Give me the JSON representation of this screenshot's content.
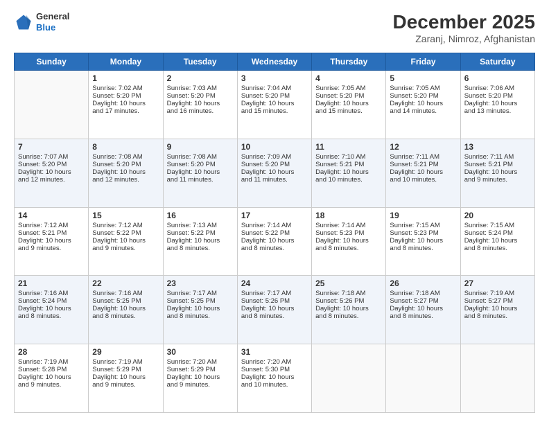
{
  "header": {
    "logo": {
      "general": "General",
      "blue": "Blue"
    },
    "title": "December 2025",
    "subtitle": "Zaranj, Nimroz, Afghanistan"
  },
  "days_of_week": [
    "Sunday",
    "Monday",
    "Tuesday",
    "Wednesday",
    "Thursday",
    "Friday",
    "Saturday"
  ],
  "weeks": [
    [
      {
        "num": "",
        "lines": []
      },
      {
        "num": "1",
        "lines": [
          "Sunrise: 7:02 AM",
          "Sunset: 5:20 PM",
          "Daylight: 10 hours",
          "and 17 minutes."
        ]
      },
      {
        "num": "2",
        "lines": [
          "Sunrise: 7:03 AM",
          "Sunset: 5:20 PM",
          "Daylight: 10 hours",
          "and 16 minutes."
        ]
      },
      {
        "num": "3",
        "lines": [
          "Sunrise: 7:04 AM",
          "Sunset: 5:20 PM",
          "Daylight: 10 hours",
          "and 15 minutes."
        ]
      },
      {
        "num": "4",
        "lines": [
          "Sunrise: 7:05 AM",
          "Sunset: 5:20 PM",
          "Daylight: 10 hours",
          "and 15 minutes."
        ]
      },
      {
        "num": "5",
        "lines": [
          "Sunrise: 7:05 AM",
          "Sunset: 5:20 PM",
          "Daylight: 10 hours",
          "and 14 minutes."
        ]
      },
      {
        "num": "6",
        "lines": [
          "Sunrise: 7:06 AM",
          "Sunset: 5:20 PM",
          "Daylight: 10 hours",
          "and 13 minutes."
        ]
      }
    ],
    [
      {
        "num": "7",
        "lines": [
          "Sunrise: 7:07 AM",
          "Sunset: 5:20 PM",
          "Daylight: 10 hours",
          "and 12 minutes."
        ]
      },
      {
        "num": "8",
        "lines": [
          "Sunrise: 7:08 AM",
          "Sunset: 5:20 PM",
          "Daylight: 10 hours",
          "and 12 minutes."
        ]
      },
      {
        "num": "9",
        "lines": [
          "Sunrise: 7:08 AM",
          "Sunset: 5:20 PM",
          "Daylight: 10 hours",
          "and 11 minutes."
        ]
      },
      {
        "num": "10",
        "lines": [
          "Sunrise: 7:09 AM",
          "Sunset: 5:20 PM",
          "Daylight: 10 hours",
          "and 11 minutes."
        ]
      },
      {
        "num": "11",
        "lines": [
          "Sunrise: 7:10 AM",
          "Sunset: 5:21 PM",
          "Daylight: 10 hours",
          "and 10 minutes."
        ]
      },
      {
        "num": "12",
        "lines": [
          "Sunrise: 7:11 AM",
          "Sunset: 5:21 PM",
          "Daylight: 10 hours",
          "and 10 minutes."
        ]
      },
      {
        "num": "13",
        "lines": [
          "Sunrise: 7:11 AM",
          "Sunset: 5:21 PM",
          "Daylight: 10 hours",
          "and 9 minutes."
        ]
      }
    ],
    [
      {
        "num": "14",
        "lines": [
          "Sunrise: 7:12 AM",
          "Sunset: 5:21 PM",
          "Daylight: 10 hours",
          "and 9 minutes."
        ]
      },
      {
        "num": "15",
        "lines": [
          "Sunrise: 7:12 AM",
          "Sunset: 5:22 PM",
          "Daylight: 10 hours",
          "and 9 minutes."
        ]
      },
      {
        "num": "16",
        "lines": [
          "Sunrise: 7:13 AM",
          "Sunset: 5:22 PM",
          "Daylight: 10 hours",
          "and 8 minutes."
        ]
      },
      {
        "num": "17",
        "lines": [
          "Sunrise: 7:14 AM",
          "Sunset: 5:22 PM",
          "Daylight: 10 hours",
          "and 8 minutes."
        ]
      },
      {
        "num": "18",
        "lines": [
          "Sunrise: 7:14 AM",
          "Sunset: 5:23 PM",
          "Daylight: 10 hours",
          "and 8 minutes."
        ]
      },
      {
        "num": "19",
        "lines": [
          "Sunrise: 7:15 AM",
          "Sunset: 5:23 PM",
          "Daylight: 10 hours",
          "and 8 minutes."
        ]
      },
      {
        "num": "20",
        "lines": [
          "Sunrise: 7:15 AM",
          "Sunset: 5:24 PM",
          "Daylight: 10 hours",
          "and 8 minutes."
        ]
      }
    ],
    [
      {
        "num": "21",
        "lines": [
          "Sunrise: 7:16 AM",
          "Sunset: 5:24 PM",
          "Daylight: 10 hours",
          "and 8 minutes."
        ]
      },
      {
        "num": "22",
        "lines": [
          "Sunrise: 7:16 AM",
          "Sunset: 5:25 PM",
          "Daylight: 10 hours",
          "and 8 minutes."
        ]
      },
      {
        "num": "23",
        "lines": [
          "Sunrise: 7:17 AM",
          "Sunset: 5:25 PM",
          "Daylight: 10 hours",
          "and 8 minutes."
        ]
      },
      {
        "num": "24",
        "lines": [
          "Sunrise: 7:17 AM",
          "Sunset: 5:26 PM",
          "Daylight: 10 hours",
          "and 8 minutes."
        ]
      },
      {
        "num": "25",
        "lines": [
          "Sunrise: 7:18 AM",
          "Sunset: 5:26 PM",
          "Daylight: 10 hours",
          "and 8 minutes."
        ]
      },
      {
        "num": "26",
        "lines": [
          "Sunrise: 7:18 AM",
          "Sunset: 5:27 PM",
          "Daylight: 10 hours",
          "and 8 minutes."
        ]
      },
      {
        "num": "27",
        "lines": [
          "Sunrise: 7:19 AM",
          "Sunset: 5:27 PM",
          "Daylight: 10 hours",
          "and 8 minutes."
        ]
      }
    ],
    [
      {
        "num": "28",
        "lines": [
          "Sunrise: 7:19 AM",
          "Sunset: 5:28 PM",
          "Daylight: 10 hours",
          "and 9 minutes."
        ]
      },
      {
        "num": "29",
        "lines": [
          "Sunrise: 7:19 AM",
          "Sunset: 5:29 PM",
          "Daylight: 10 hours",
          "and 9 minutes."
        ]
      },
      {
        "num": "30",
        "lines": [
          "Sunrise: 7:20 AM",
          "Sunset: 5:29 PM",
          "Daylight: 10 hours",
          "and 9 minutes."
        ]
      },
      {
        "num": "31",
        "lines": [
          "Sunrise: 7:20 AM",
          "Sunset: 5:30 PM",
          "Daylight: 10 hours",
          "and 10 minutes."
        ]
      },
      {
        "num": "",
        "lines": []
      },
      {
        "num": "",
        "lines": []
      },
      {
        "num": "",
        "lines": []
      }
    ]
  ]
}
